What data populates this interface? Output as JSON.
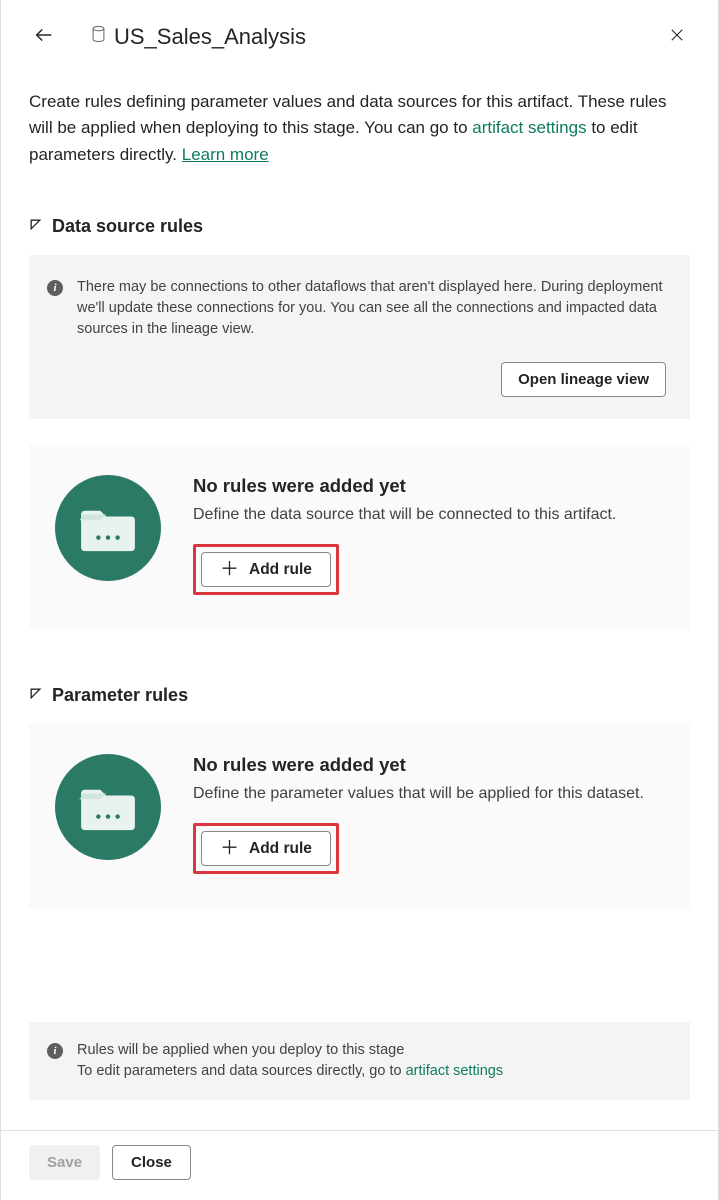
{
  "header": {
    "artifact_name": "US_Sales_Analysis"
  },
  "description": {
    "text_part1": "Create rules defining parameter values and data sources for this artifact. These rules will be applied when deploying to this stage. You can go to ",
    "link1": "artifact settings",
    "text_part2": " to edit parameters directly. ",
    "link2": "Learn more"
  },
  "sections": {
    "data_source": {
      "title": "Data source rules",
      "info_text": "There may be connections to other dataflows that aren't displayed here. During deployment we'll update these connections for you. You can see all the connections and impacted data sources in the lineage view.",
      "open_lineage_label": "Open lineage view",
      "empty_title": "No rules were added yet",
      "empty_desc": "Define the data source that will be connected to this artifact.",
      "add_rule_label": "Add rule"
    },
    "parameter": {
      "title": "Parameter rules",
      "empty_title": "No rules were added yet",
      "empty_desc": "Define the parameter values that will be applied for this dataset.",
      "add_rule_label": "Add rule"
    }
  },
  "footer_info": {
    "line1": "Rules will be applied when you deploy to this stage",
    "line2_part1": "To edit parameters and data sources directly, go to ",
    "line2_link": "artifact settings"
  },
  "footer": {
    "save_label": "Save",
    "close_label": "Close"
  }
}
